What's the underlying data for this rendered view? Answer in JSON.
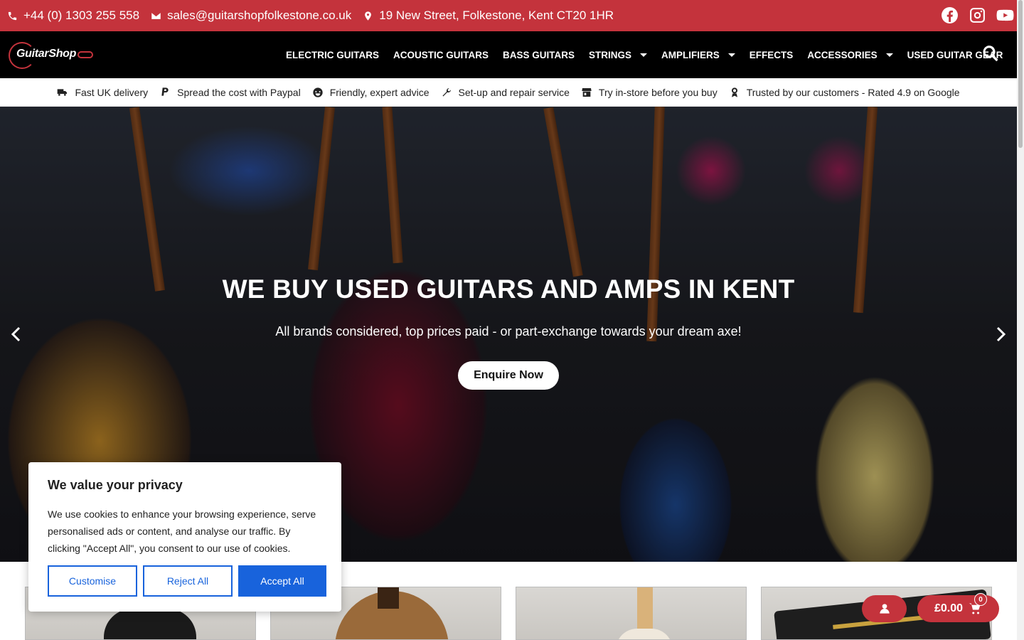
{
  "topbar": {
    "phone": "+44 (0) 1303 255 558",
    "email": "sales@guitarshopfolkestone.co.uk",
    "address": "19 New Street, Folkestone, Kent CT20 1HR",
    "social": [
      "facebook-icon",
      "instagram-icon",
      "youtube-icon"
    ]
  },
  "nav": {
    "logo_text": "GuitarShop",
    "items": [
      {
        "label": "ELECTRIC GUITARS",
        "dropdown": false
      },
      {
        "label": "ACOUSTIC GUITARS",
        "dropdown": false
      },
      {
        "label": "BASS GUITARS",
        "dropdown": false
      },
      {
        "label": "STRINGS",
        "dropdown": true
      },
      {
        "label": "AMPLIFIERS",
        "dropdown": true
      },
      {
        "label": "EFFECTS",
        "dropdown": false
      },
      {
        "label": "ACCESSORIES",
        "dropdown": true
      },
      {
        "label": "USED GUITAR GEAR",
        "dropdown": false
      }
    ]
  },
  "usps": [
    {
      "icon": "truck-icon",
      "label": "Fast UK delivery"
    },
    {
      "icon": "paypal-icon",
      "label": "Spread the cost with Paypal"
    },
    {
      "icon": "smile-icon",
      "label": "Friendly, expert advice"
    },
    {
      "icon": "wrench-icon",
      "label": "Set-up and repair service"
    },
    {
      "icon": "store-icon",
      "label": "Try in-store before you buy"
    },
    {
      "icon": "award-icon",
      "label": "Trusted by our customers - Rated 4.9 on Google"
    }
  ],
  "hero": {
    "title": "WE BUY USED GUITARS AND AMPS IN KENT",
    "subtitle": "All brands considered, top prices paid - or part-exchange towards your dream axe!",
    "cta": "Enquire Now"
  },
  "cookie": {
    "title": "We value your privacy",
    "body": "We use cookies to enhance your browsing experience, serve personalised ads or content, and analyse our traffic. By clicking \"Accept All\", you consent to our use of cookies.",
    "customise": "Customise",
    "reject": "Reject All",
    "accept": "Accept All"
  },
  "cart": {
    "total": "£0.00",
    "count": "0"
  },
  "colors": {
    "brand_red": "#c4333c",
    "cookie_blue": "#1863dc"
  }
}
